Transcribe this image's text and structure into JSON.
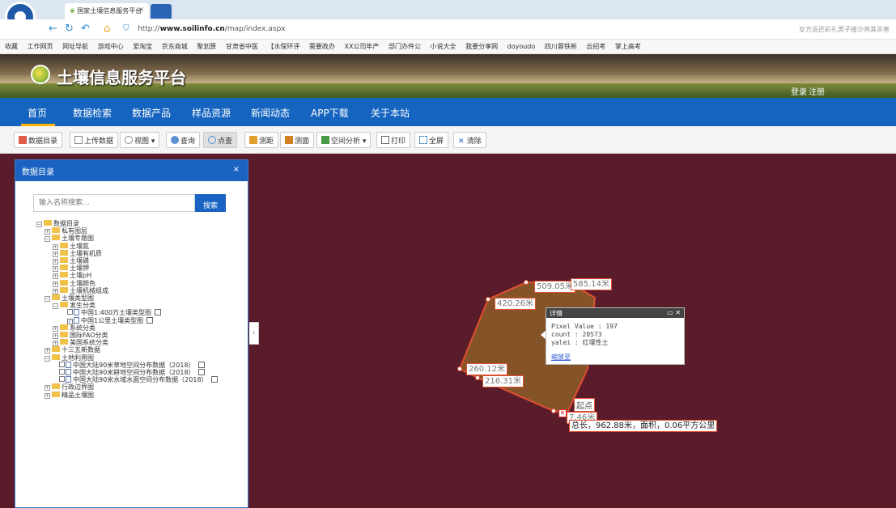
{
  "browser": {
    "tab_title": "国家土壤信息服务平台",
    "tab_close": "×",
    "url_prefix": "http://",
    "url_host": "www.soilinfo.cn",
    "url_path": "/map/index.aspx",
    "addr_right": "女方返还彩礼男子搂沙将其杀害"
  },
  "favorites": [
    "收藏",
    "工作网页",
    "网址导航",
    "游戏中心",
    "爱淘宝",
    "京东商城",
    "聚划算",
    "甘肃省中医",
    "【水保环评",
    "需要政办",
    "XX公司年产",
    "部门办件公",
    "小说大全",
    "我要分享网",
    "doyoudo",
    "四川蓉铁新",
    "云招考",
    "掌上高考"
  ],
  "site": {
    "title": "土壤信息服务平台",
    "login": "登录",
    "register": "注册"
  },
  "nav": [
    "首页",
    "数据检索",
    "数据产品",
    "样品资源",
    "新闻动态",
    "APP下载",
    "关于本站"
  ],
  "toolbar": {
    "catalog": "数据目录",
    "upload": "上传数据",
    "view": "视图",
    "query": "查询",
    "point_query": "点查",
    "measure_distance": "测距",
    "measure_area": "测面",
    "spatial_analysis": "空间分析",
    "print": "打印",
    "fullscreen": "全屏",
    "clear": "清除"
  },
  "panel": {
    "title": "数据目录",
    "close": "×",
    "search_placeholder": "输入名称搜索...",
    "search_button": "搜索",
    "tree": {
      "root": "数据目录",
      "private": "私有图层",
      "soil_thematic": "土壤专题图",
      "nitrogen": "土壤氮",
      "organic": "土壤有机质",
      "phosphorus": "土壤磷",
      "potassium": "土壤钾",
      "ph": "土壤pH",
      "color": "土壤颜色",
      "texture": "土壤机械组成",
      "soil_type": "土壤类型图",
      "genetic": "发生分类",
      "map_400w": "中国1:400万土壤类型图",
      "map_1km": "中国1公里土壤类型图",
      "system": "系统分类",
      "fao": "国际FAO分类",
      "usa": "美国系统分类",
      "plan135": "十三五新数据",
      "landuse": "土地利用图",
      "lu_grass": "中国大陆90米草地空间分布数据（2018）",
      "lu_crop": "中国大陆90米耕地空间分布数据（2018）",
      "lu_water": "中国大陆90米水域水面空间分布数据（2018）",
      "admin": "行政边界图",
      "fine": "精品土壤图"
    }
  },
  "measure": {
    "segments": [
      "509.05米",
      "585.14米",
      "420.26米",
      "260.12米",
      "216.31米",
      "7.46米"
    ],
    "start": "起点",
    "total": "总长，962.88米，面积，0.06平方公里"
  },
  "popup": {
    "title": "详情",
    "pixel_value": "Pixel Value : 197",
    "count": "count : 20573",
    "yalei": "yalei : 红壤性土",
    "zoom": "缩放至"
  },
  "colors": {
    "nav_blue": "#1565c0",
    "map_bg": "#5a1c2b",
    "polygon_fill": "#8a5a28",
    "polygon_stroke": "#e05030"
  }
}
